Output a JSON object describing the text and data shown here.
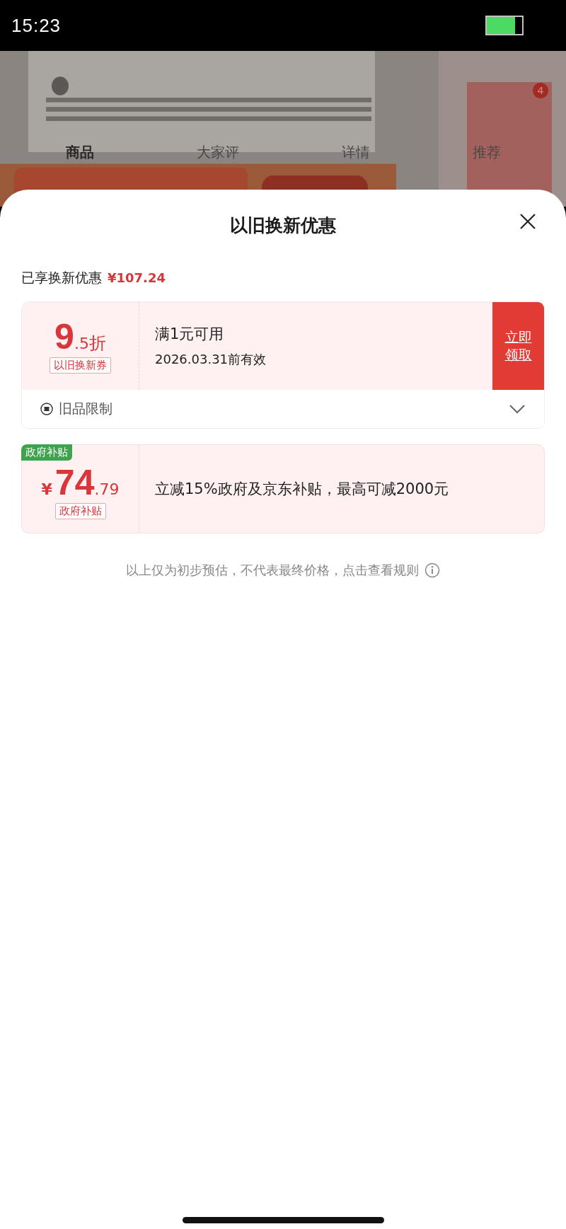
{
  "status_bar": {
    "time": "15:23"
  },
  "background_page": {
    "tabs": [
      {
        "label": "商品",
        "selected": true
      },
      {
        "label": "大家评",
        "selected": false
      },
      {
        "label": "详情",
        "selected": false
      },
      {
        "label": "推荐",
        "selected": false
      }
    ],
    "badge": "4"
  },
  "sheet": {
    "title": "以旧换新优惠",
    "summary": {
      "label": "已享换新优惠",
      "amount": "¥107.24"
    },
    "coupon": {
      "value_main": "9",
      "value_minor": ".5",
      "unit": "折",
      "tag": "以旧换新券",
      "condition": "满1元可用",
      "validity": "2026.03.31前有效",
      "action": "立即领取",
      "restriction": {
        "label": "旧品限制",
        "expanded": false
      }
    },
    "subsidy": {
      "corner_tag": "政府补贴",
      "currency": "¥",
      "value_main": "74",
      "value_minor": ".79",
      "tag": "政府补贴",
      "description": "立减15%政府及京东补贴，最高可减2000元"
    },
    "footer_note": "以上仅为初步预估，不代表最终价格，点击查看规则"
  }
}
